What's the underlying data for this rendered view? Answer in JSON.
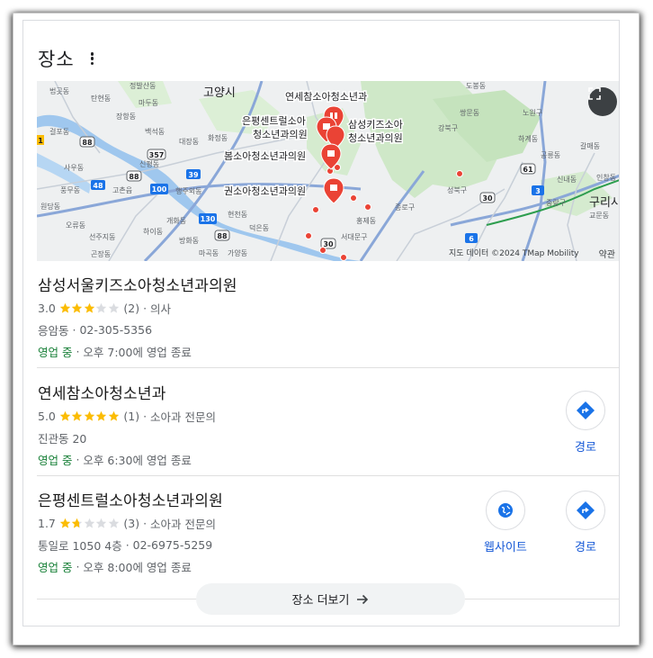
{
  "section": {
    "title": "장소",
    "more_options_icon": "kebab-menu-icon"
  },
  "map": {
    "attribution": "지도 데이터 ©2024 TMap Mobility",
    "report_label": "약관",
    "expand_icon": "expand-icon",
    "labels": {
      "city_goyang": "고양시",
      "city_guri": "구리시",
      "pin_yonsei": "연세참소아청소년과",
      "pin_eunpyeong": "은평센트럴소아",
      "pin_eunpyeong2": "청소년과의원",
      "pin_samsung": "삼성키즈소아",
      "pin_samsung2": "청소년과의원",
      "pin_bom": "봄소아청소년과의원",
      "pin_kwon": "권소아청소년과의원",
      "d1": "정발산동",
      "d2": "탄현동",
      "d3": "법곳동",
      "d4": "마두동",
      "d5": "장항동",
      "d6": "백석동",
      "d7": "걸포동",
      "d8": "대장동",
      "d9": "화정동",
      "d10": "사우동",
      "d11": "신평동",
      "d12": "풍무동",
      "d13": "고촌읍",
      "d14": "행주외동",
      "d15": "원당동",
      "d16": "오류동",
      "d17": "선주지동",
      "d18": "하이동",
      "d19": "개화동",
      "d20": "방화동",
      "d21": "현천동",
      "d22": "덕은동",
      "d23": "마곡동",
      "d24": "가양동",
      "d25": "곤장동",
      "d26": "도봉동",
      "d27": "쌍문동",
      "d28": "노원구",
      "d29": "강북구",
      "d30": "하계동",
      "d31": "공릉동",
      "d32": "성북구",
      "d33": "종로구",
      "d34": "홍제동",
      "d35": "서대문구",
      "d36": "신내동",
      "d37": "중랑구",
      "d38": "인창동",
      "d39": "교문동",
      "d40": "갈매동",
      "r88a": "88",
      "r88b": "88",
      "r88c": "88",
      "r357": "357",
      "r39": "39",
      "r48": "48",
      "r100": "100",
      "r130": "130",
      "r30": "30",
      "r30b": "30",
      "r6": "6",
      "r3": "3",
      "r61": "61",
      "r1": "1"
    }
  },
  "places": [
    {
      "name": "삼성서울키즈소아청소년과의원",
      "rating": "3.0",
      "stars": 3.0,
      "reviews": "(2)",
      "category": "의사",
      "address": "응암동",
      "phone": "02-305-5356",
      "status": "영업 중",
      "hours": "오후 7:00에 영업 종료"
    },
    {
      "name": "연세참소아청소년과",
      "rating": "5.0",
      "stars": 5.0,
      "reviews": "(1)",
      "category": "소아과 전문의",
      "address": "진관동 20",
      "status": "영업 중",
      "hours": "오후 6:30에 영업 종료",
      "directions_label": "경로",
      "directions_icon": "directions-icon"
    },
    {
      "name": "은평센트럴소아청소년과의원",
      "rating": "1.7",
      "stars": 1.7,
      "reviews": "(3)",
      "category": "소아과 전문의",
      "address": "통일로 1050 4층",
      "phone": "02-6975-5259",
      "status": "영업 중",
      "hours": "오후 8:00에 영업 종료",
      "website_label": "웹사이트",
      "website_icon": "globe-icon",
      "directions_label": "경로",
      "directions_icon": "directions-icon"
    }
  ],
  "more": {
    "label": "장소 더보기",
    "icon": "arrow-right-icon"
  },
  "colors": {
    "open_green": "#188038",
    "star_gold": "#fbbc04",
    "link_blue": "#1558d6",
    "pin_red": "#ea4335"
  }
}
